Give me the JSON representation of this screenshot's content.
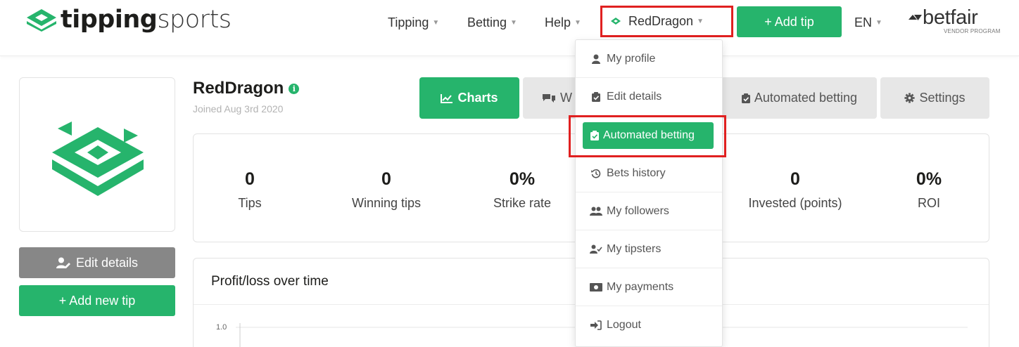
{
  "brand": {
    "logo_bold": "tipping",
    "logo_light": "sports"
  },
  "nav": {
    "tipping": "Tipping",
    "betting": "Betting",
    "help": "Help",
    "user": "RedDragon",
    "add_tip": "+ Add tip",
    "language": "EN",
    "partner": "betfair",
    "partner_sub": "VENDOR PROGRAM"
  },
  "sidebar": {
    "edit_details": "Edit details",
    "add_new_tip": "+ Add new tip"
  },
  "profile": {
    "name": "RedDragon",
    "joined": "Joined Aug 3rd 2020"
  },
  "tabs": {
    "charts": "Charts",
    "w": "W",
    "automated_betting": "Automated betting",
    "settings": "Settings"
  },
  "stats": [
    {
      "value": "0",
      "label": "Tips"
    },
    {
      "value": "0",
      "label": "Winning tips"
    },
    {
      "value": "0%",
      "label": "Strike rate"
    },
    {
      "value": "0",
      "label": "Invested (points)"
    },
    {
      "value": "0%",
      "label": "ROI"
    }
  ],
  "chart_panel": {
    "title": "Profit/loss over time",
    "y_tick_top": "1.0"
  },
  "dropdown": {
    "items": [
      {
        "label": "My profile",
        "icon": "user-icon"
      },
      {
        "label": "Edit details",
        "icon": "clipboard-icon"
      },
      {
        "label": "Automated betting",
        "icon": "clipboard-check-icon",
        "active": true
      },
      {
        "label": "Bets history",
        "icon": "history-icon"
      },
      {
        "label": "My followers",
        "icon": "users-icon"
      },
      {
        "label": "My tipsters",
        "icon": "user-check-icon"
      },
      {
        "label": "My payments",
        "icon": "money-icon"
      },
      {
        "label": "Logout",
        "icon": "sign-out-icon"
      }
    ]
  },
  "colors": {
    "brand_green": "#26b46c",
    "highlight_red": "#e02020",
    "button_grey": "#878787",
    "tab_grey": "#e7e7e7"
  }
}
